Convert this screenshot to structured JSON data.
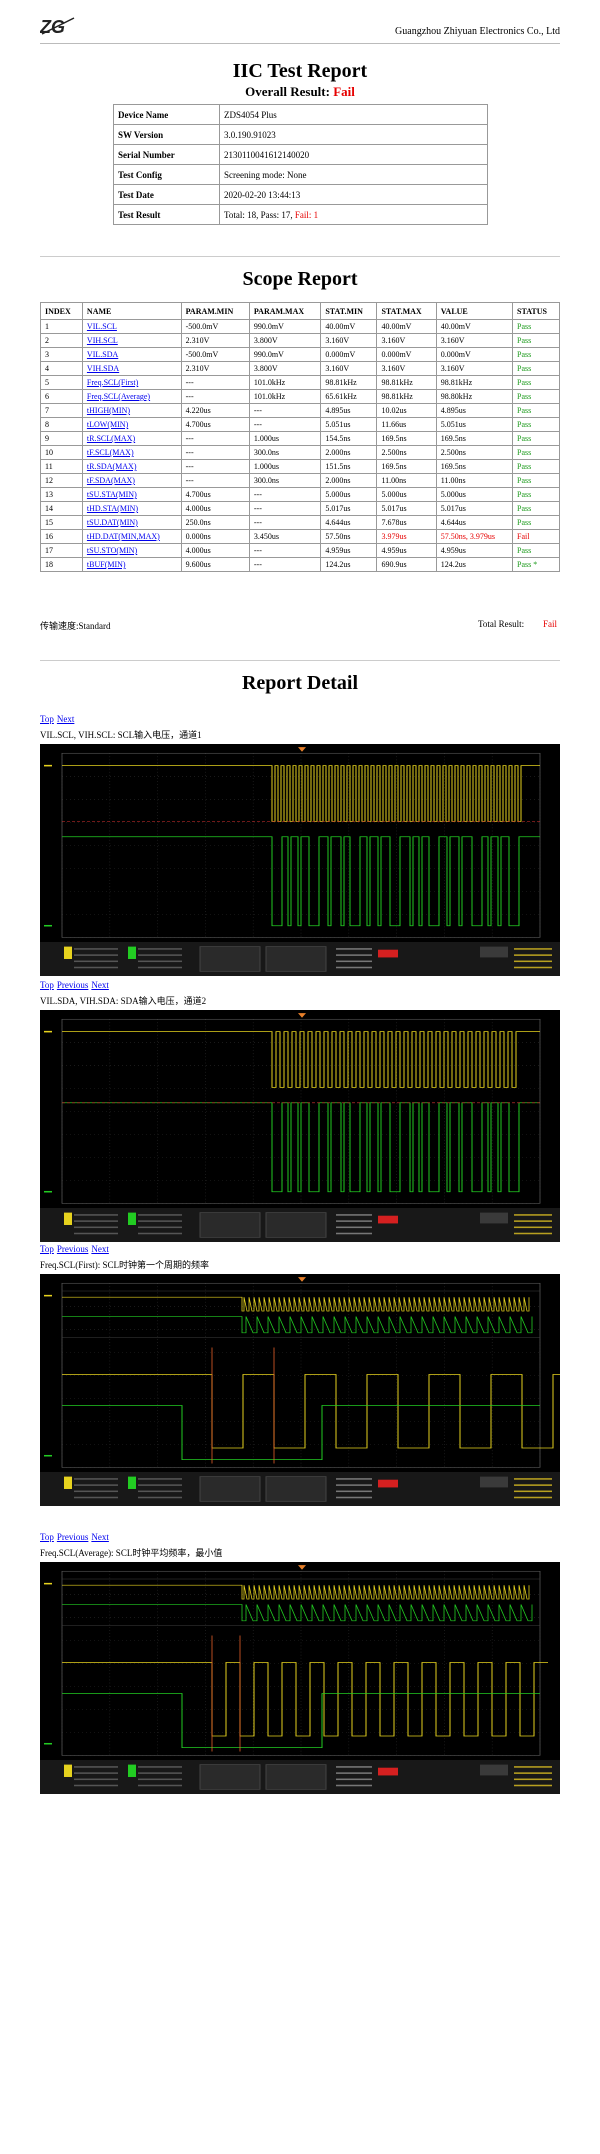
{
  "header": {
    "company": "Guangzhou Zhiyuan Electronics Co., Ltd"
  },
  "report": {
    "title": "IIC Test Report",
    "overall_label": "Overall Result: ",
    "overall_value": "Fail"
  },
  "info": [
    {
      "key": "Device Name",
      "value": "ZDS4054 Plus"
    },
    {
      "key": "SW Version",
      "value": "3.0.190.91023"
    },
    {
      "key": "Serial Number",
      "value": "2130110041612140020"
    },
    {
      "key": "Test Config",
      "value": "Screening mode: None"
    },
    {
      "key": "Test Date",
      "value": "2020-02-20 13:44:13"
    },
    {
      "key": "Test Result",
      "value": "Total: 18, Pass: 17, ",
      "fail": "Fail: 1"
    }
  ],
  "scope": {
    "title": "Scope Report",
    "columns": [
      "INDEX",
      "NAME",
      "PARAM.MIN",
      "PARAM.MAX",
      "STAT.MIN",
      "STAT.MAX",
      "VALUE",
      "STATUS"
    ],
    "rows": [
      [
        "1",
        "VIL.SCL",
        "-500.0mV",
        "990.0mV",
        "40.00mV",
        "40.00mV",
        "40.00mV",
        "Pass"
      ],
      [
        "2",
        "VIH.SCL",
        "2.310V",
        "3.800V",
        "3.160V",
        "3.160V",
        "3.160V",
        "Pass"
      ],
      [
        "3",
        "VIL.SDA",
        "-500.0mV",
        "990.0mV",
        "0.000mV",
        "0.000mV",
        "0.000mV",
        "Pass"
      ],
      [
        "4",
        "VIH.SDA",
        "2.310V",
        "3.800V",
        "3.160V",
        "3.160V",
        "3.160V",
        "Pass"
      ],
      [
        "5",
        "Freq.SCL(First)",
        "---",
        "101.0kHz",
        "98.81kHz",
        "98.81kHz",
        "98.81kHz",
        "Pass"
      ],
      [
        "6",
        "Freq.SCL(Average)",
        "---",
        "101.0kHz",
        "65.61kHz",
        "98.81kHz",
        "98.80kHz",
        "Pass"
      ],
      [
        "7",
        "tHIGH(MIN)",
        "4.220us",
        "---",
        "4.895us",
        "10.02us",
        "4.895us",
        "Pass"
      ],
      [
        "8",
        "tLOW(MIN)",
        "4.700us",
        "---",
        "5.051us",
        "11.66us",
        "5.051us",
        "Pass"
      ],
      [
        "9",
        "tR.SCL(MAX)",
        "---",
        "1.000us",
        "154.5ns",
        "169.5ns",
        "169.5ns",
        "Pass"
      ],
      [
        "10",
        "tF.SCL(MAX)",
        "---",
        "300.0ns",
        "2.000ns",
        "2.500ns",
        "2.500ns",
        "Pass"
      ],
      [
        "11",
        "tR.SDA(MAX)",
        "---",
        "1.000us",
        "151.5ns",
        "169.5ns",
        "169.5ns",
        "Pass"
      ],
      [
        "12",
        "tF.SDA(MAX)",
        "---",
        "300.0ns",
        "2.000ns",
        "11.00ns",
        "11.00ns",
        "Pass"
      ],
      [
        "13",
        "tSU.STA(MIN)",
        "4.700us",
        "---",
        "5.000us",
        "5.000us",
        "5.000us",
        "Pass"
      ],
      [
        "14",
        "tHD.STA(MIN)",
        "4.000us",
        "---",
        "5.017us",
        "5.017us",
        "5.017us",
        "Pass"
      ],
      [
        "15",
        "tSU.DAT(MIN)",
        "250.0ns",
        "---",
        "4.644us",
        "7.678us",
        "4.644us",
        "Pass"
      ],
      [
        "16",
        "tHD.DAT(MIN,MAX)",
        "0.000ns",
        "3.450us",
        "57.50ns",
        "3.979us",
        "57.50ns, 3.979us",
        "Fail"
      ],
      [
        "17",
        "tSU.STO(MIN)",
        "4.000us",
        "---",
        "4.959us",
        "4.959us",
        "4.959us",
        "Pass"
      ],
      [
        "18",
        "tBUF(MIN)",
        "9.600us",
        "---",
        "124.2us",
        "690.9us",
        "124.2us",
        "Pass *"
      ]
    ],
    "speed": "传输速度:Standard",
    "total_label": "Total Result:",
    "total_value": "Fail"
  },
  "detail": {
    "title": "Report Detail",
    "nav_top": "Top",
    "nav_previous": "Previous",
    "nav_next": "Next",
    "sections": [
      {
        "caption": "VIL.SCL, VIH.SCL: SCL输入电压，通道1"
      },
      {
        "caption": "VIL.SDA, VIH.SDA: SDA输入电压，通道2"
      },
      {
        "caption": "Freq.SCL(First): SCL时钟第一个周期的频率"
      },
      {
        "caption": "Freq.SCL(Average): SCL时钟平均频率，最小值"
      }
    ]
  },
  "colors": {
    "fail": "#e60000",
    "pass": "#1a9a1a",
    "ch1": "#e6d21e",
    "ch2": "#22cc22",
    "link": "#0000ee"
  }
}
